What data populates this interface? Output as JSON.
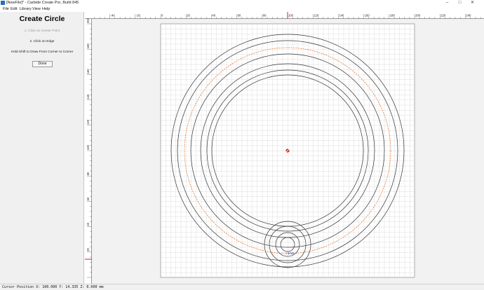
{
  "window": {
    "title": "[NewFile]* - Carbide Create Pro, Build 845",
    "controls": {
      "minimize": "–",
      "maximize": "□",
      "close": "✕"
    }
  },
  "menu": {
    "items": [
      {
        "label": "File"
      },
      {
        "label": "Edit"
      },
      {
        "label": "Library"
      },
      {
        "label": "View"
      },
      {
        "label": "Help"
      }
    ]
  },
  "panel": {
    "title": "Create Circle",
    "steps": [
      {
        "label": "1. Click on Center Point",
        "state": "done"
      },
      {
        "label": "2. Click on Edge",
        "state": "active"
      }
    ],
    "hint": "Hold Shift to Draw From Corner to Corner",
    "done_label": "Done"
  },
  "rulers": {
    "top_labels": [
      "-40",
      "-20",
      "0",
      "20",
      "40",
      "60",
      "80",
      "100",
      "120",
      "140",
      "160",
      "180",
      "200",
      "220",
      "240"
    ],
    "left_labels": [
      "200",
      "180",
      "160",
      "140",
      "120",
      "100",
      "80",
      "60",
      "40",
      "20"
    ]
  },
  "canvas": {
    "stock_color": "#ffffff",
    "grid_color": "#dcdcdc",
    "line_color": "#333333",
    "selected_color": "#e06a1e",
    "marker_color": "#d92020",
    "label": "1mm"
  },
  "status": {
    "text": "Cursor Position X: 100.000 Y: 14.335 Z: 0.000 mm"
  }
}
